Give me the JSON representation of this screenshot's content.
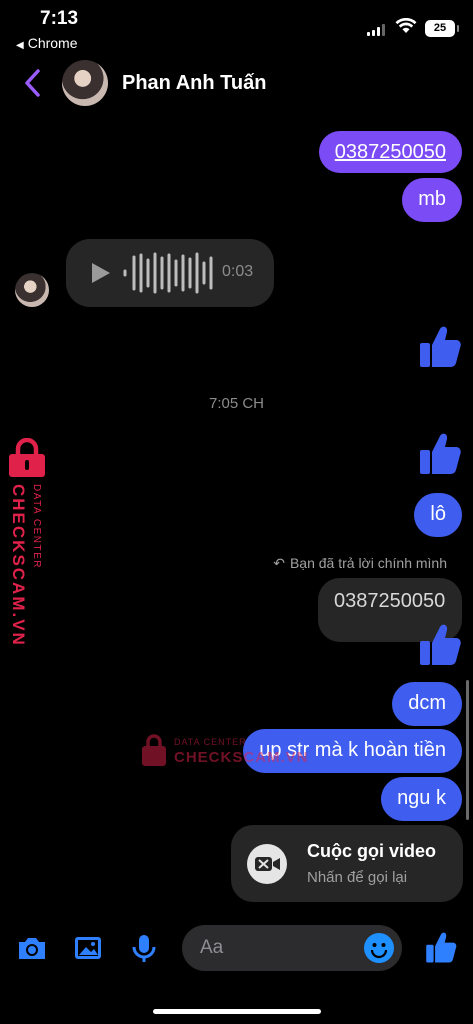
{
  "status_bar": {
    "time": "7:13",
    "back_app": "Chrome",
    "battery": "25"
  },
  "header": {
    "contact_name": "Phan Anh Tuấn"
  },
  "messages": {
    "phone_out": "0387250050",
    "mb": "mb",
    "voice_duration": "0:03",
    "timestamp": "7:05 CH",
    "lo": "lô",
    "reply_note": "Bạn đã trả lời chính mình",
    "quoted_phone": "0387250050",
    "dcm": "dcm",
    "up_str": "up str mà k hoàn tiền",
    "ngu_k": "ngu k"
  },
  "call_card": {
    "title": "Cuộc gọi video",
    "subtitle": "Nhấn để gọi lại"
  },
  "composer": {
    "placeholder": "Aa"
  },
  "watermark": {
    "brand": "CHECKSCAM.VN",
    "tagline": "DATA CENTER"
  },
  "colors": {
    "purple": "#7b4cf5",
    "blue": "#3f5ef0",
    "accent": "#1e90ff",
    "watermark": "#e0224a"
  }
}
